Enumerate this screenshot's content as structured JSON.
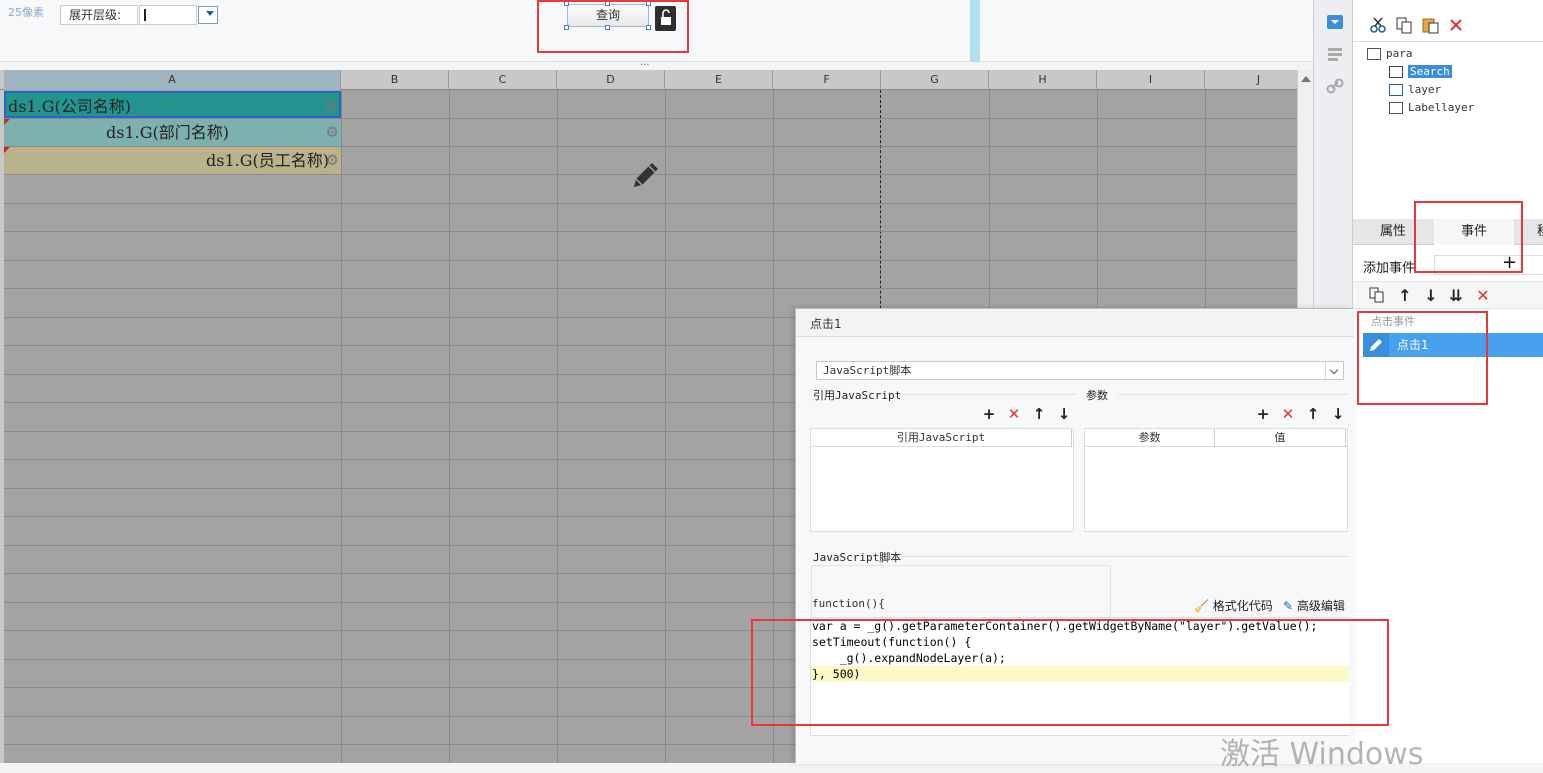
{
  "param_bar": {
    "pixel_hint": "25像素",
    "level_label": "展开层级:",
    "query_button": "查询"
  },
  "sheet": {
    "columns": [
      "A",
      "B",
      "C",
      "D",
      "E",
      "F",
      "G",
      "H",
      "I",
      "J"
    ],
    "cells": {
      "a1": "ds1.G(公司名称)",
      "a2": "ds1.G(部门名称)",
      "a3": "ds1.G(员工名称)"
    }
  },
  "widget_tree": {
    "root": "para",
    "items": [
      "Search",
      "layer",
      "Labellayer"
    ]
  },
  "right_panel": {
    "tabs": [
      "属性",
      "事件",
      "移"
    ],
    "add_event_label": "添加事件",
    "event_group": "点击事件",
    "event_item": "点击1"
  },
  "dialog": {
    "title": "点击1",
    "script_type": "JavaScript脚本",
    "ref_js_label": "引用JavaScript",
    "params_label": "参数",
    "ref_js_col": "引用JavaScript",
    "param_col_name": "参数",
    "param_col_value": "值",
    "script_label": "JavaScript脚本",
    "function_sig": "function(){",
    "format_code": "格式化代码",
    "advanced_edit": "高级编辑",
    "code_lines": [
      "var a = _g().getParameterContainer().getWidgetByName(\"layer\").getValue();",
      "setTimeout(function() {",
      "    _g().expandNodeLayer(a);",
      "}, 500)"
    ]
  },
  "watermark": "激活 Windows",
  "colors": {
    "accent_blue": "#3b8edb",
    "annotation_red": "#e8393a",
    "cell_a1": "#23958e",
    "cell_a2": "#7fb0b0",
    "cell_a3": "#b9b28c"
  }
}
